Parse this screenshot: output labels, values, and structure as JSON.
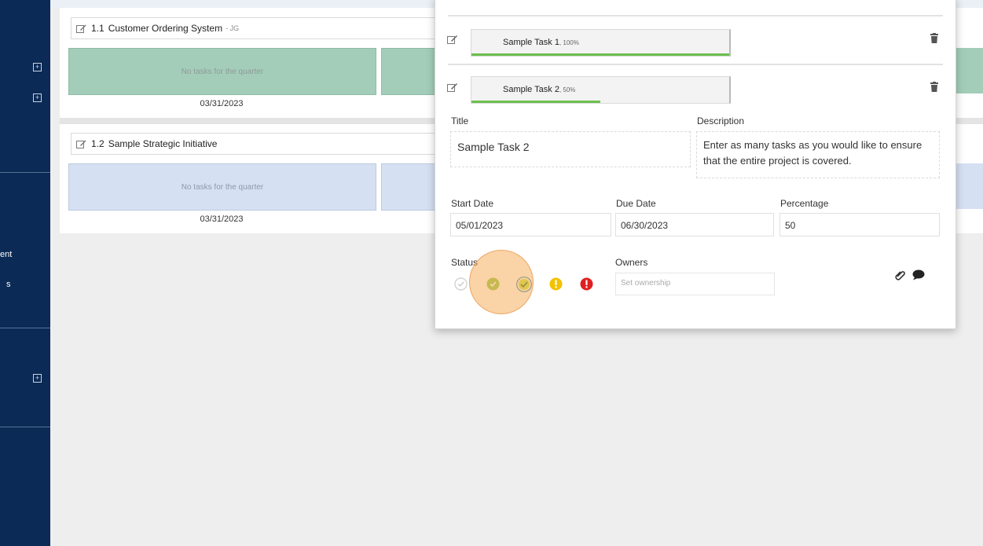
{
  "sidebar": {
    "partial_texts": [
      "ent",
      "s"
    ]
  },
  "initiatives": [
    {
      "number": "1.1",
      "title": "Customer Ordering System",
      "owner_suffix": "- JG",
      "empty_text": "No tasks for the quarter",
      "date": "03/31/2023",
      "color": "#a3cdb9"
    },
    {
      "number": "1.2",
      "title": "Sample Strategic Initiative",
      "empty_text": "No tasks for the quarter",
      "date": "03/31/2023",
      "color": "#d6e0f3"
    }
  ],
  "modal": {
    "tasks": [
      {
        "name": "Sample Task 1",
        "percent_label": ", 100%",
        "progress": 100
      },
      {
        "name": "Sample Task 2",
        "percent_label": ", 50%",
        "progress": 50
      }
    ],
    "form": {
      "title_label": "Title",
      "title_value": "Sample Task 2",
      "description_label": "Description",
      "description_value": "Enter as many tasks as you would like to ensure that the entire project is covered.",
      "start_date_label": "Start Date",
      "start_date_value": "05/01/2023",
      "due_date_label": "Due Date",
      "due_date_value": "06/30/2023",
      "percentage_label": "Percentage",
      "percentage_value": "50",
      "status_label": "Status",
      "owners_label": "Owners",
      "owners_placeholder": "Set ownership"
    },
    "status_options": [
      {
        "name": "not-started",
        "color": "#cccccc"
      },
      {
        "name": "on-track",
        "color": "#8cc63f"
      },
      {
        "name": "complete",
        "color": "#8cc63f"
      },
      {
        "name": "at-risk",
        "color": "#f2c200"
      },
      {
        "name": "off-track",
        "color": "#e02020"
      }
    ]
  },
  "colors": {
    "sidebar": "#0b2a55",
    "progress_green": "#6cbf4f",
    "click_highlight": "#f6ae5e"
  }
}
